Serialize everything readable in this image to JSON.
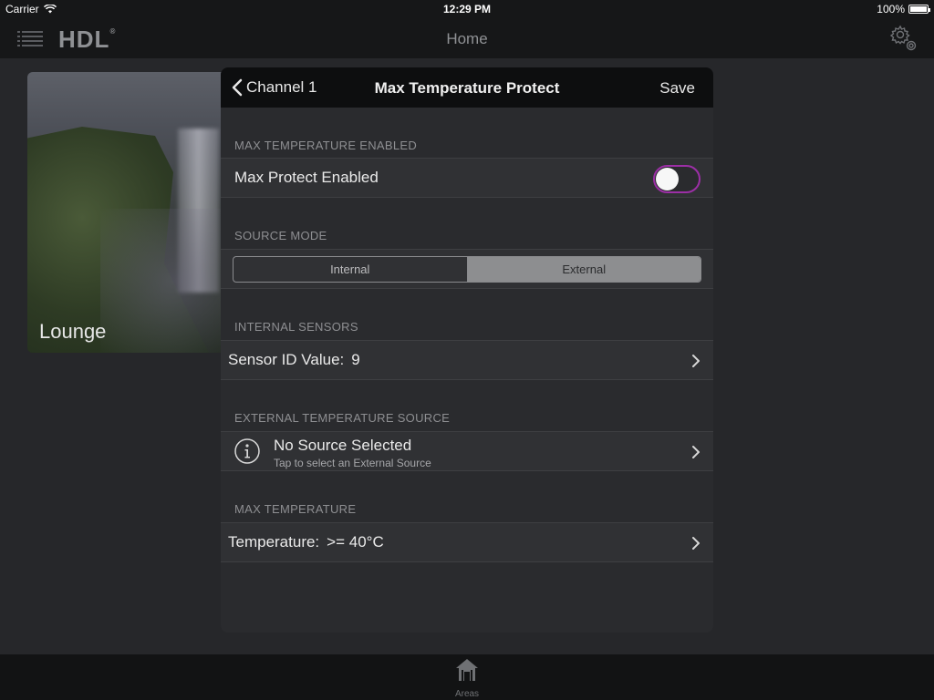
{
  "status_bar": {
    "carrier": "Carrier",
    "time": "12:29 PM",
    "battery": "100%"
  },
  "navbar": {
    "logo": "HDL",
    "logo_mark": "®",
    "title": "Home"
  },
  "background": {
    "area_card_label": "Lounge"
  },
  "modal": {
    "back_label": "Channel 1",
    "title": "Max Temperature Protect",
    "save_label": "Save",
    "sections": {
      "enabled_header": "MAX TEMPERATURE ENABLED",
      "enabled_label": "Max Protect Enabled",
      "enabled_state": "off",
      "source_mode_header": "SOURCE MODE",
      "source_mode_options": [
        "Internal",
        "External"
      ],
      "source_mode_selected": "External",
      "internal_sensors_header": "INTERNAL SENSORS",
      "sensor_id_label": "Sensor ID Value:",
      "sensor_id_value": "9",
      "external_source_header": "EXTERNAL TEMPERATURE SOURCE",
      "external_source_title": "No Source Selected",
      "external_source_subtitle": "Tap to select an External Source",
      "max_temp_header": "MAX TEMPERATURE",
      "temperature_label": "Temperature:",
      "temperature_value": ">= 40°C"
    }
  },
  "tabbar": {
    "areas_label": "Areas"
  },
  "colors": {
    "accent": "#9c2fa6",
    "background": "#26272a",
    "bar": "#161718"
  }
}
